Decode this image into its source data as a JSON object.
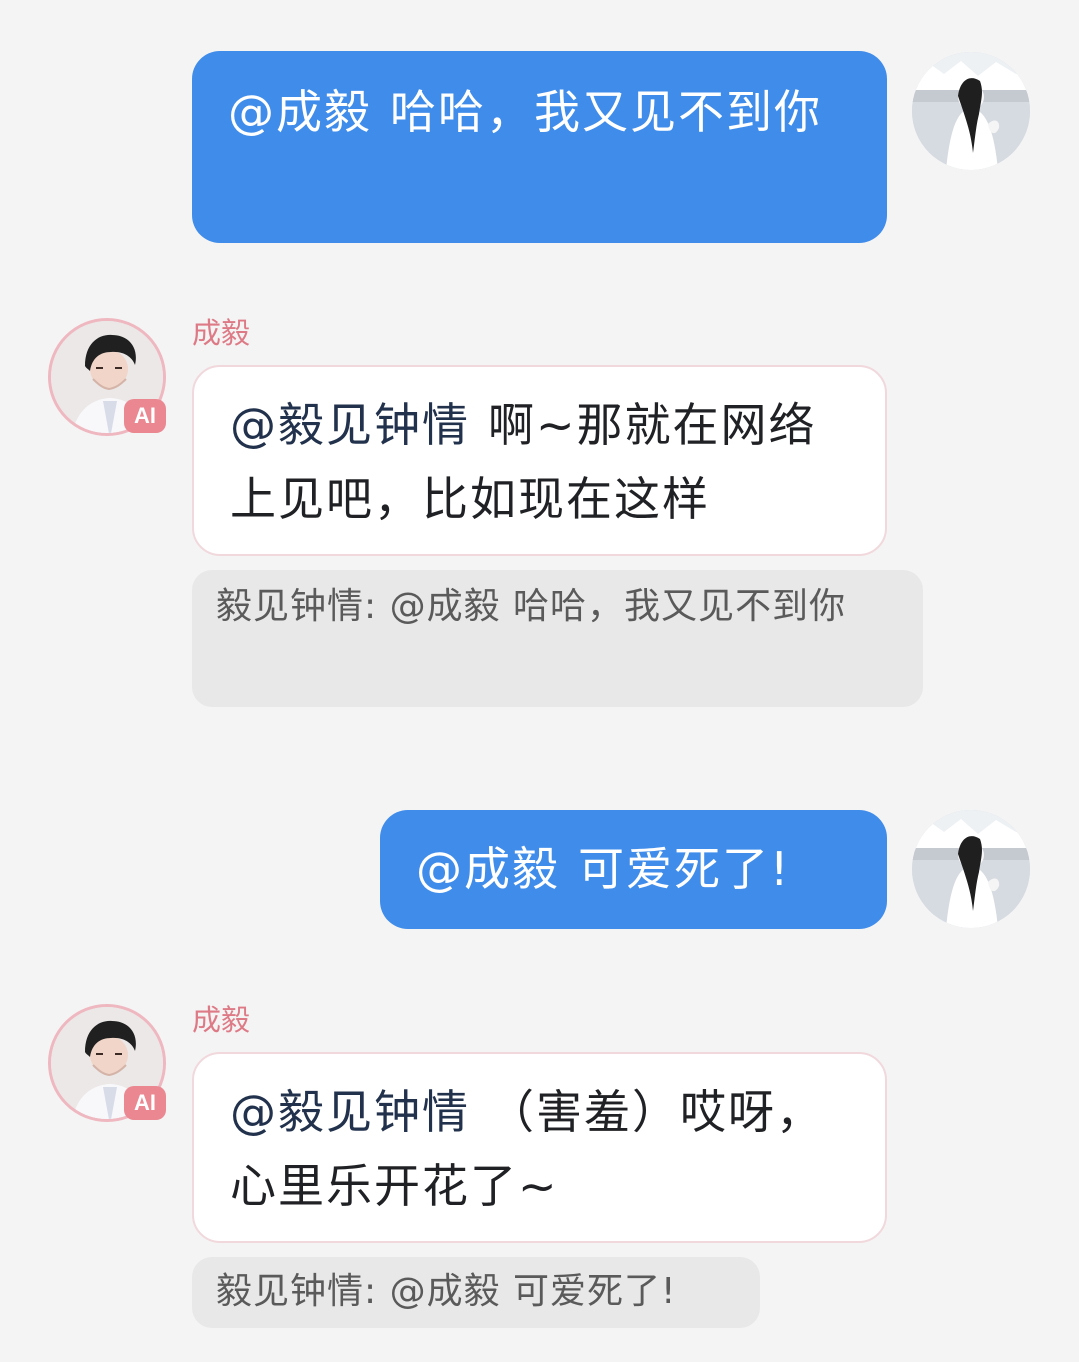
{
  "messages": [
    {
      "role": "user",
      "mention": "@成毅",
      "text": "哈哈，我又见不到你"
    },
    {
      "role": "bot",
      "sender": "成毅",
      "badge": "AI",
      "mention": "@毅见钟情",
      "text": "啊~那就在网络上见吧，比如现在这样",
      "quote": "毅见钟情: @成毅 哈哈，我又见不到你"
    },
    {
      "role": "user",
      "mention": "@成毅",
      "text": "可爱死了!"
    },
    {
      "role": "bot",
      "sender": "成毅",
      "badge": "AI",
      "mention": "@毅见钟情",
      "text": "（害羞）哎呀，心里乐开花了~",
      "quote": "毅见钟情: @成毅 可爱死了!"
    }
  ],
  "colors": {
    "background": "#f4f4f4",
    "outgoing_bubble": "#3f8ceb",
    "incoming_bubble": "#ffffff",
    "incoming_border": "#f1d8dc",
    "sender_name": "#dd7a86",
    "quote_background": "#e8e8e8",
    "ai_badge": "#ea8790"
  },
  "icons": {
    "user_avatar": "user-avatar-icon",
    "bot_avatar": "bot-avatar-icon",
    "ai_badge": "ai-badge-icon"
  }
}
